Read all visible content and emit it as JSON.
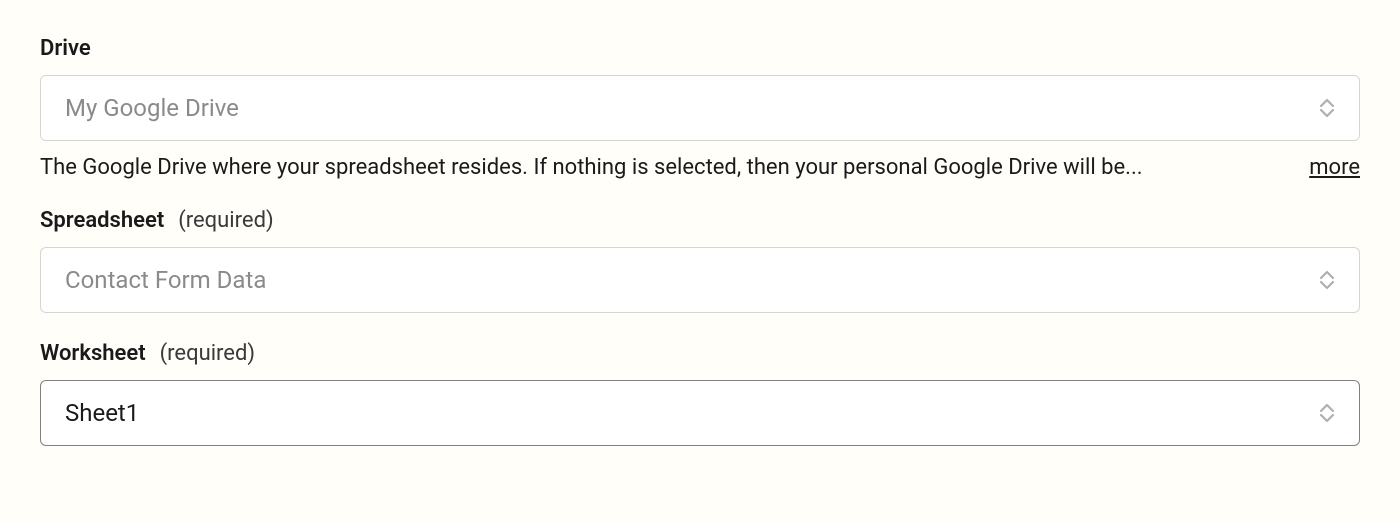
{
  "fields": {
    "drive": {
      "label": "Drive",
      "value": "My Google Drive",
      "help": "The Google Drive where your spreadsheet resides. If nothing is selected, then your personal Google Drive will be...",
      "more": "more"
    },
    "spreadsheet": {
      "label": "Spreadsheet",
      "required": "(required)",
      "value": "Contact Form Data"
    },
    "worksheet": {
      "label": "Worksheet",
      "required": "(required)",
      "value": "Sheet1"
    }
  }
}
